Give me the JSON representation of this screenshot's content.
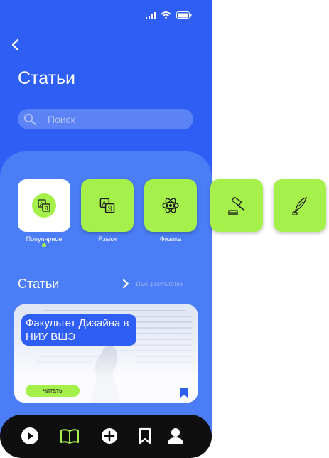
{
  "header": {
    "title": "Статьи",
    "search_placeholder": "Поиск"
  },
  "status_icons": [
    "signal-icon",
    "wifi-icon",
    "battery-icon"
  ],
  "categories": [
    {
      "label": "Популярное",
      "icon": "translate-icon",
      "selected": true
    },
    {
      "label": "Языки",
      "icon": "translate-icon",
      "selected": false
    },
    {
      "label": "Физика",
      "icon": "atom-icon",
      "selected": false
    },
    {
      "label": "",
      "icon": "gavel-icon",
      "selected": false
    },
    {
      "label": "",
      "icon": "quill-icon",
      "selected": false
    }
  ],
  "section": {
    "title": "Статьи",
    "results": "1тыс. результатов"
  },
  "card": {
    "headline": "Факультет Дизайна в НИУ ВШЭ",
    "button_label": "читать"
  },
  "nav": [
    "play-icon",
    "book-icon",
    "add-icon",
    "bookmark-icon",
    "profile-icon"
  ],
  "colors": {
    "primary": "#2f5ef5",
    "panel": "#4b7df7",
    "accent": "#a5f04a",
    "nav_bg": "#0f0f0f"
  }
}
